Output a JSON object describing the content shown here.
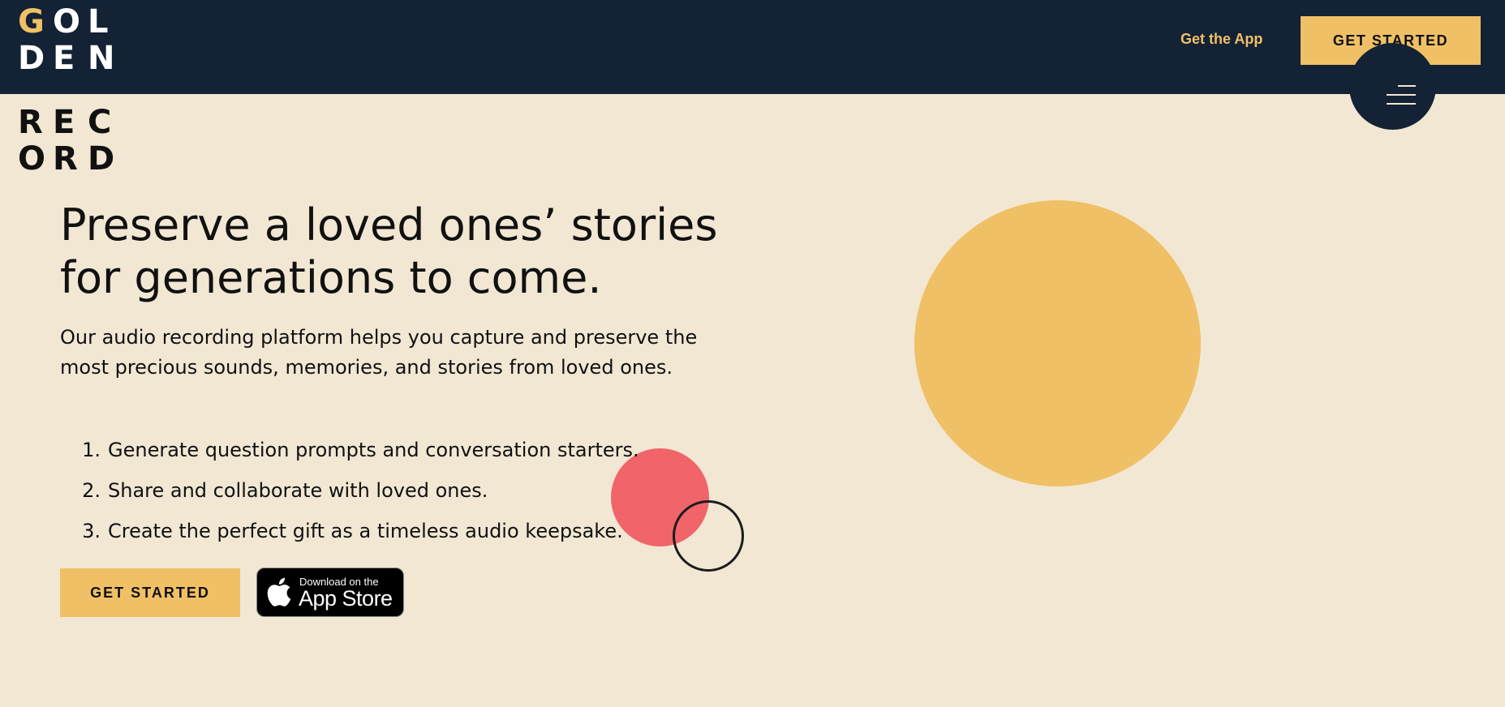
{
  "header": {
    "logo": {
      "top_rows": [
        [
          "G",
          "O",
          "L"
        ],
        [
          "D",
          "E",
          "N"
        ]
      ],
      "bottom_rows": [
        [
          "R",
          "E",
          "C"
        ],
        [
          "O",
          "R",
          "D"
        ]
      ]
    },
    "get_app_label": "Get the App",
    "cta_label": "GET STARTED",
    "menu_icon": "hamburger-menu-icon"
  },
  "hero": {
    "headline": "Preserve a loved ones’ stories for generations to come.",
    "intro": "Our audio recording platform helps you capture and preserve the most precious sounds, memories, and stories from loved ones.",
    "features": [
      {
        "num": "1.",
        "text": "Generate question prompts and conversation starters."
      },
      {
        "num": "2.",
        "text": "Share and collaborate with loved ones."
      },
      {
        "num": "3.",
        "text": "Create the perfect gift as a timeless audio keepsake."
      }
    ],
    "cta_label": "GET STARTED",
    "app_store": {
      "icon": "apple-logo-icon",
      "small_text": "Download on the",
      "big_text": "App Store"
    }
  },
  "colors": {
    "navy": "#132235",
    "gold": "#f0c066",
    "cream": "#f2e7d3",
    "coral": "#f0646a",
    "text": "#111111"
  }
}
